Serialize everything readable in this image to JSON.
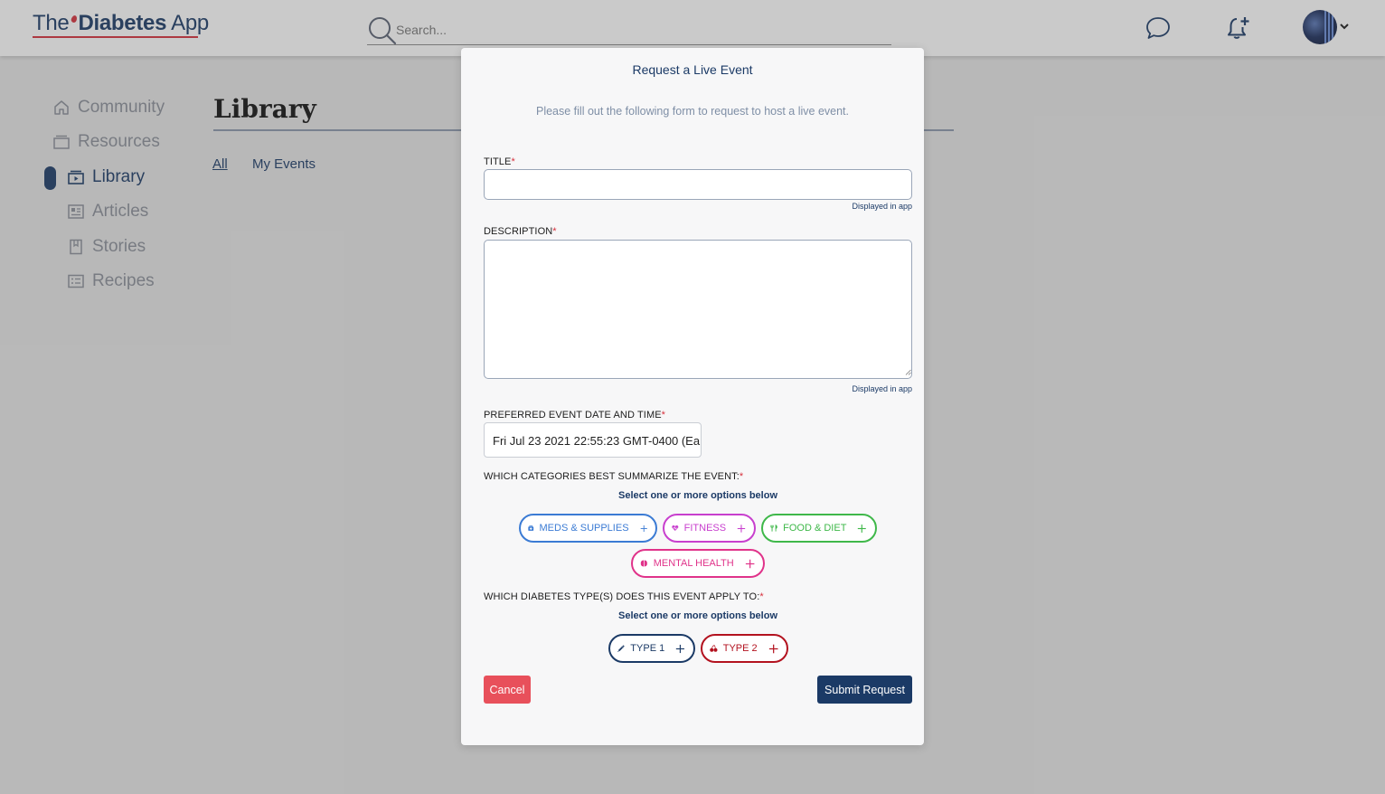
{
  "header": {
    "logo": {
      "the": "The",
      "brand": "Diabetes",
      "app": "App"
    },
    "search": {
      "placeholder": "Search...",
      "value": ""
    },
    "icons": [
      "search-icon",
      "chat-icon",
      "bell-plus-icon",
      "chevron-down-icon"
    ]
  },
  "sidebar": {
    "items": [
      {
        "label": "Community",
        "icon": "home-icon",
        "active": false
      },
      {
        "label": "Resources",
        "icon": "folder-icon",
        "active": false
      },
      {
        "label": "Library",
        "icon": "video-library-icon",
        "active": true
      },
      {
        "label": "Articles",
        "icon": "newspaper-icon",
        "active": false
      },
      {
        "label": "Stories",
        "icon": "book-icon",
        "active": false
      },
      {
        "label": "Recipes",
        "icon": "list-icon",
        "active": false
      }
    ]
  },
  "main": {
    "title": "Library",
    "tabs": [
      {
        "label": "All",
        "selected": true
      },
      {
        "label": "My Events",
        "selected": false
      }
    ]
  },
  "modal": {
    "title": "Request a Live Event",
    "subtitle": "Please fill out the following form to request to host a live event.",
    "title_field": {
      "label": "TITLE",
      "value": "",
      "hint": "Displayed in app"
    },
    "description_field": {
      "label": "DESCRIPTION",
      "value": "",
      "hint": "Displayed in app"
    },
    "date_field": {
      "label": "PREFERRED EVENT DATE AND TIME",
      "value": "Fri Jul 23 2021 22:55:23 GMT-0400 (Ea"
    },
    "categories": {
      "label": "WHICH CATEGORIES BEST SUMMARIZE THE EVENT:",
      "hint": "Select one or more options below",
      "options": [
        {
          "label": "MEDS & SUPPLIES",
          "icon": "briefcase-medical-icon",
          "color": "#3b7bd4"
        },
        {
          "label": "FITNESS",
          "icon": "heart-pulse-icon",
          "color": "#c83fce"
        },
        {
          "label": "FOOD & DIET",
          "icon": "utensils-icon",
          "color": "#3fb84a"
        },
        {
          "label": "MENTAL HEALTH",
          "icon": "brain-icon",
          "color": "#e0338a"
        }
      ]
    },
    "types": {
      "label": "WHICH DIABETES TYPE(S) DOES THIS EVENT APPLY TO:",
      "hint": "Select one or more options below",
      "options": [
        {
          "label": "TYPE 1",
          "icon": "syringe-icon",
          "color": "#1b3a66"
        },
        {
          "label": "TYPE 2",
          "icon": "cherries-icon",
          "color": "#b3121f"
        }
      ]
    },
    "required_mark": "*",
    "cancel_label": "Cancel",
    "submit_label": "Submit Request"
  },
  "colors": {
    "brand_navy": "#1b3a66",
    "brand_red": "#d6303c",
    "cancel_red": "#e8505b"
  }
}
